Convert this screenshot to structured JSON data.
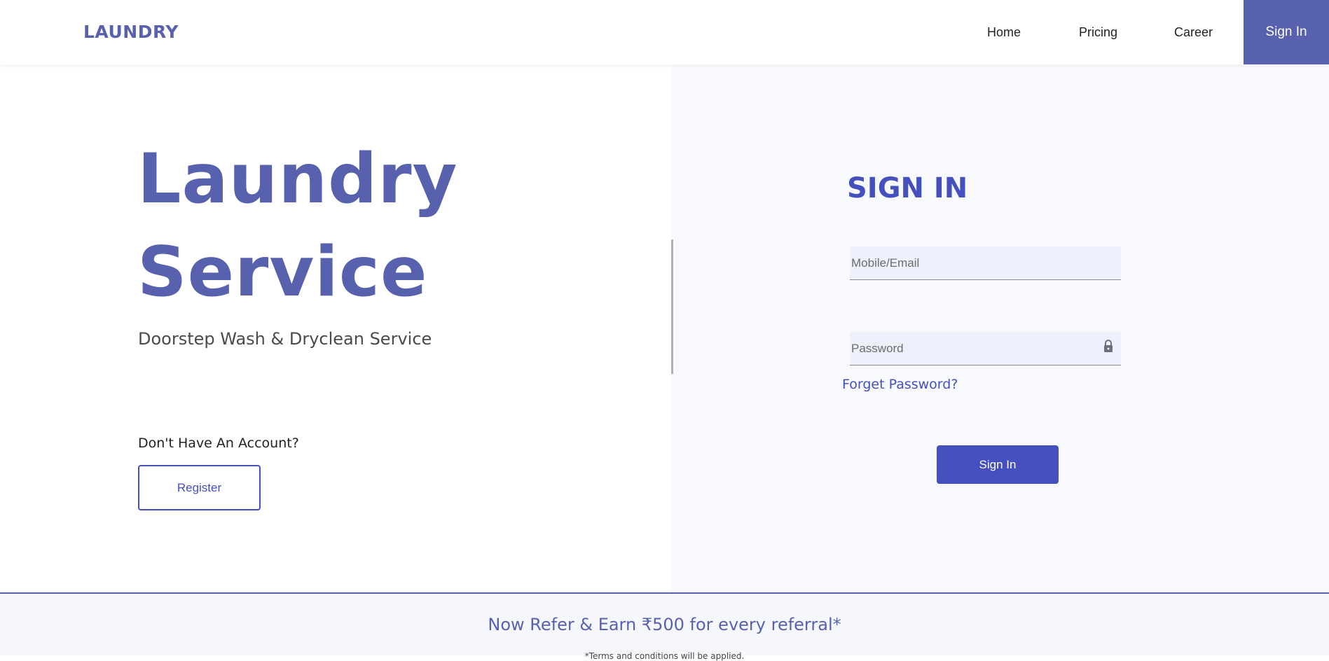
{
  "nav": {
    "brand": "LAUNDRY",
    "links": [
      "Home",
      "Pricing",
      "Career"
    ],
    "signin_label": "Sign In"
  },
  "hero": {
    "title_line1": "Laundry",
    "title_line2": "Service",
    "subtitle": "Doorstep Wash & Dryclean Service",
    "no_account": "Don't Have An Account?",
    "register_label": "Register"
  },
  "signin": {
    "title": "SIGN IN",
    "email_placeholder": "Mobile/Email",
    "password_placeholder": "Password",
    "forget_label": "Forget Password?",
    "button_label": "Sign In"
  },
  "footer": {
    "refer_text": "Now Refer & Earn ₹500 for every referral*",
    "terms_text": "*Terms and conditions will be applied."
  },
  "colors": {
    "brand": "#5861ae",
    "accent": "#4550bf",
    "panel_bg": "#f8f9fd"
  }
}
